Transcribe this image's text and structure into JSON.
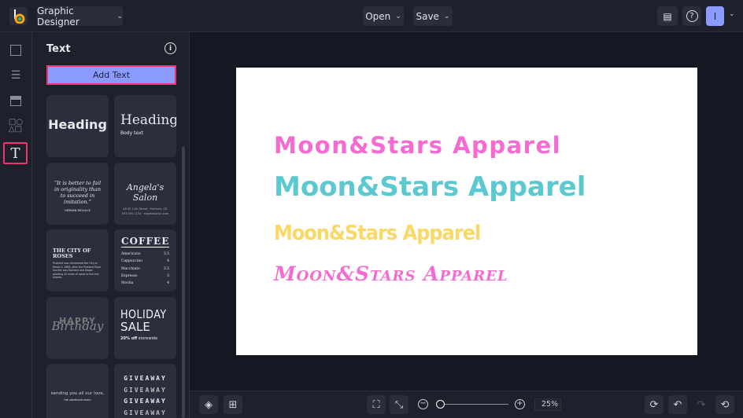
{
  "header": {
    "project_name": "Graphic Designer",
    "open_label": "Open",
    "save_label": "Save",
    "avatar_initial": "I"
  },
  "panel": {
    "title": "Text",
    "add_text_label": "Add Text",
    "tiles": {
      "heading_bold": "Heading",
      "heading_serif": "Heading",
      "body_text": "Body text",
      "quote": "“It is better to fail in originality than to succeed in imitation.”",
      "quote_author": "HERMAN MELVILLE",
      "salon_title": "Angela's Salon",
      "salon_address": "48 SE 11th Street · Portland, OR",
      "salon_contact": "503 555 1234 · angelassalon.com",
      "city_title": "THE CITY OF ROSES",
      "city_body": "Portland was nicknamed the City of Roses in 1888, after the Portland Rose Society was founded and began planting 20 miles of roses to line the streets.",
      "coffee_title": "COFFEE",
      "coffee_menu": [
        {
          "item": "Americano",
          "price": "3.5"
        },
        {
          "item": "Cappuccino",
          "price": "4"
        },
        {
          "item": "Macchiato",
          "price": "3.5"
        },
        {
          "item": "Espresso",
          "price": "3"
        },
        {
          "item": "Mocha",
          "price": "4"
        }
      ],
      "happy": "HAPPY",
      "birthday": "Birthday",
      "holiday": "HOLIDAY",
      "sale": "SALE",
      "sale_sub_bold": "20% off",
      "sale_sub": "storewide",
      "love": "sending you all our love,",
      "love_sub": "THE ANDERSON FAMILY",
      "giveaway": [
        "GIVEAWAY",
        "GIVEAWAY",
        "GIVEAWAY",
        "GIVEAWAY"
      ]
    }
  },
  "canvas": {
    "lines": [
      "Moon&Stars Apparel",
      "Moon&Stars Apparel",
      "Moon&Stars Apparel",
      "Moon&Stars Apparel"
    ],
    "colors": [
      "#f56bd2",
      "#5cc8d0",
      "#fbd766",
      "#f56bd2"
    ]
  },
  "footer": {
    "zoom": "25%",
    "zoom_fraction": 0.0
  }
}
